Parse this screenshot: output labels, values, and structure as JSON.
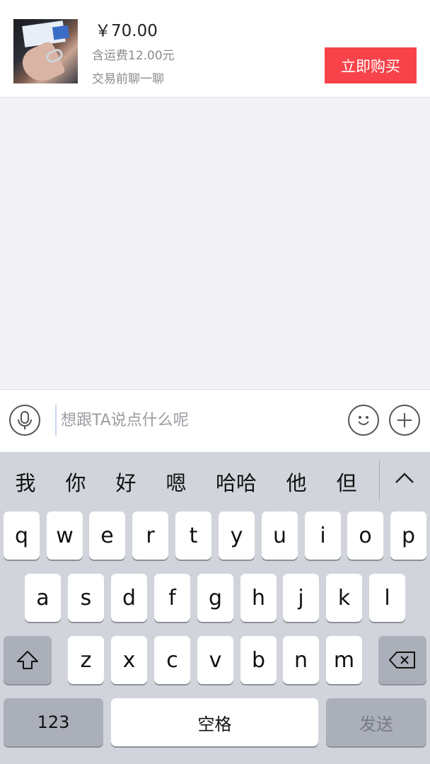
{
  "product": {
    "price": "￥70.00",
    "shipping": "含运费12.00元",
    "chat_hint": "交易前聊一聊",
    "buy_label": "立即购买",
    "buy_color": "#f8434b"
  },
  "input": {
    "placeholder": "想跟TA说点什么呢",
    "value": ""
  },
  "icons": {
    "voice": "microphone-icon",
    "emoji": "smiley-icon",
    "more": "plus-icon",
    "shift": "shift-arrow-icon",
    "delete": "backspace-icon",
    "expand": "chevron-up-icon"
  },
  "keyboard": {
    "candidates": [
      "我",
      "你",
      "好",
      "嗯",
      "哈哈",
      "他",
      "但"
    ],
    "row1": [
      "q",
      "w",
      "e",
      "r",
      "t",
      "y",
      "u",
      "i",
      "o",
      "p"
    ],
    "row2": [
      "a",
      "s",
      "d",
      "f",
      "g",
      "h",
      "j",
      "k",
      "l"
    ],
    "row3": [
      "z",
      "x",
      "c",
      "v",
      "b",
      "n",
      "m"
    ],
    "numbers_label": "123",
    "space_label": "空格",
    "send_label": "发送"
  }
}
